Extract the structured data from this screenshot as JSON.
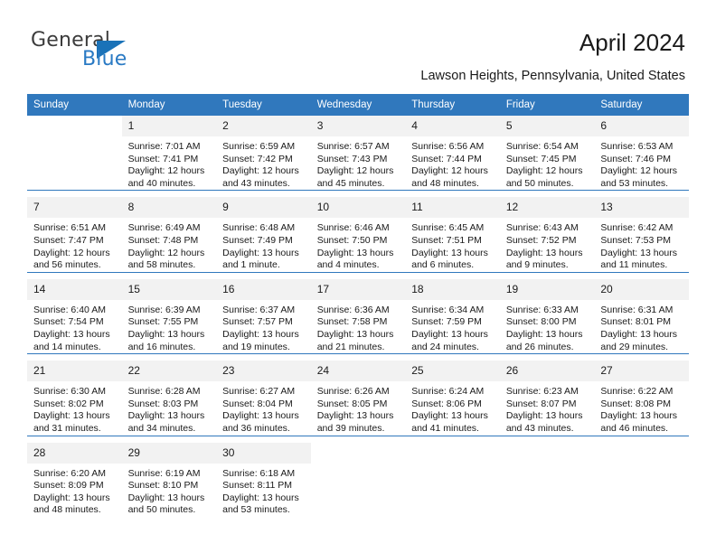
{
  "logo": {
    "word_top": "General",
    "word_bottom": "Blue",
    "accent_color": "#1a72b8"
  },
  "header": {
    "title": "April 2024",
    "location": "Lawson Heights, Pennsylvania, United States"
  },
  "theme": {
    "header_blue": "#3078bd",
    "daynum_band": "#f2f2f2"
  },
  "calendar": {
    "weekdays": [
      "Sunday",
      "Monday",
      "Tuesday",
      "Wednesday",
      "Thursday",
      "Friday",
      "Saturday"
    ],
    "weeks": [
      [
        {
          "day": "",
          "sunrise": "",
          "sunset": "",
          "daylight": ""
        },
        {
          "day": "1",
          "sunrise": "Sunrise: 7:01 AM",
          "sunset": "Sunset: 7:41 PM",
          "daylight": "Daylight: 12 hours and 40 minutes."
        },
        {
          "day": "2",
          "sunrise": "Sunrise: 6:59 AM",
          "sunset": "Sunset: 7:42 PM",
          "daylight": "Daylight: 12 hours and 43 minutes."
        },
        {
          "day": "3",
          "sunrise": "Sunrise: 6:57 AM",
          "sunset": "Sunset: 7:43 PM",
          "daylight": "Daylight: 12 hours and 45 minutes."
        },
        {
          "day": "4",
          "sunrise": "Sunrise: 6:56 AM",
          "sunset": "Sunset: 7:44 PM",
          "daylight": "Daylight: 12 hours and 48 minutes."
        },
        {
          "day": "5",
          "sunrise": "Sunrise: 6:54 AM",
          "sunset": "Sunset: 7:45 PM",
          "daylight": "Daylight: 12 hours and 50 minutes."
        },
        {
          "day": "6",
          "sunrise": "Sunrise: 6:53 AM",
          "sunset": "Sunset: 7:46 PM",
          "daylight": "Daylight: 12 hours and 53 minutes."
        }
      ],
      [
        {
          "day": "7",
          "sunrise": "Sunrise: 6:51 AM",
          "sunset": "Sunset: 7:47 PM",
          "daylight": "Daylight: 12 hours and 56 minutes."
        },
        {
          "day": "8",
          "sunrise": "Sunrise: 6:49 AM",
          "sunset": "Sunset: 7:48 PM",
          "daylight": "Daylight: 12 hours and 58 minutes."
        },
        {
          "day": "9",
          "sunrise": "Sunrise: 6:48 AM",
          "sunset": "Sunset: 7:49 PM",
          "daylight": "Daylight: 13 hours and 1 minute."
        },
        {
          "day": "10",
          "sunrise": "Sunrise: 6:46 AM",
          "sunset": "Sunset: 7:50 PM",
          "daylight": "Daylight: 13 hours and 4 minutes."
        },
        {
          "day": "11",
          "sunrise": "Sunrise: 6:45 AM",
          "sunset": "Sunset: 7:51 PM",
          "daylight": "Daylight: 13 hours and 6 minutes."
        },
        {
          "day": "12",
          "sunrise": "Sunrise: 6:43 AM",
          "sunset": "Sunset: 7:52 PM",
          "daylight": "Daylight: 13 hours and 9 minutes."
        },
        {
          "day": "13",
          "sunrise": "Sunrise: 6:42 AM",
          "sunset": "Sunset: 7:53 PM",
          "daylight": "Daylight: 13 hours and 11 minutes."
        }
      ],
      [
        {
          "day": "14",
          "sunrise": "Sunrise: 6:40 AM",
          "sunset": "Sunset: 7:54 PM",
          "daylight": "Daylight: 13 hours and 14 minutes."
        },
        {
          "day": "15",
          "sunrise": "Sunrise: 6:39 AM",
          "sunset": "Sunset: 7:55 PM",
          "daylight": "Daylight: 13 hours and 16 minutes."
        },
        {
          "day": "16",
          "sunrise": "Sunrise: 6:37 AM",
          "sunset": "Sunset: 7:57 PM",
          "daylight": "Daylight: 13 hours and 19 minutes."
        },
        {
          "day": "17",
          "sunrise": "Sunrise: 6:36 AM",
          "sunset": "Sunset: 7:58 PM",
          "daylight": "Daylight: 13 hours and 21 minutes."
        },
        {
          "day": "18",
          "sunrise": "Sunrise: 6:34 AM",
          "sunset": "Sunset: 7:59 PM",
          "daylight": "Daylight: 13 hours and 24 minutes."
        },
        {
          "day": "19",
          "sunrise": "Sunrise: 6:33 AM",
          "sunset": "Sunset: 8:00 PM",
          "daylight": "Daylight: 13 hours and 26 minutes."
        },
        {
          "day": "20",
          "sunrise": "Sunrise: 6:31 AM",
          "sunset": "Sunset: 8:01 PM",
          "daylight": "Daylight: 13 hours and 29 minutes."
        }
      ],
      [
        {
          "day": "21",
          "sunrise": "Sunrise: 6:30 AM",
          "sunset": "Sunset: 8:02 PM",
          "daylight": "Daylight: 13 hours and 31 minutes."
        },
        {
          "day": "22",
          "sunrise": "Sunrise: 6:28 AM",
          "sunset": "Sunset: 8:03 PM",
          "daylight": "Daylight: 13 hours and 34 minutes."
        },
        {
          "day": "23",
          "sunrise": "Sunrise: 6:27 AM",
          "sunset": "Sunset: 8:04 PM",
          "daylight": "Daylight: 13 hours and 36 minutes."
        },
        {
          "day": "24",
          "sunrise": "Sunrise: 6:26 AM",
          "sunset": "Sunset: 8:05 PM",
          "daylight": "Daylight: 13 hours and 39 minutes."
        },
        {
          "day": "25",
          "sunrise": "Sunrise: 6:24 AM",
          "sunset": "Sunset: 8:06 PM",
          "daylight": "Daylight: 13 hours and 41 minutes."
        },
        {
          "day": "26",
          "sunrise": "Sunrise: 6:23 AM",
          "sunset": "Sunset: 8:07 PM",
          "daylight": "Daylight: 13 hours and 43 minutes."
        },
        {
          "day": "27",
          "sunrise": "Sunrise: 6:22 AM",
          "sunset": "Sunset: 8:08 PM",
          "daylight": "Daylight: 13 hours and 46 minutes."
        }
      ],
      [
        {
          "day": "28",
          "sunrise": "Sunrise: 6:20 AM",
          "sunset": "Sunset: 8:09 PM",
          "daylight": "Daylight: 13 hours and 48 minutes."
        },
        {
          "day": "29",
          "sunrise": "Sunrise: 6:19 AM",
          "sunset": "Sunset: 8:10 PM",
          "daylight": "Daylight: 13 hours and 50 minutes."
        },
        {
          "day": "30",
          "sunrise": "Sunrise: 6:18 AM",
          "sunset": "Sunset: 8:11 PM",
          "daylight": "Daylight: 13 hours and 53 minutes."
        },
        {
          "day": "",
          "sunrise": "",
          "sunset": "",
          "daylight": ""
        },
        {
          "day": "",
          "sunrise": "",
          "sunset": "",
          "daylight": ""
        },
        {
          "day": "",
          "sunrise": "",
          "sunset": "",
          "daylight": ""
        },
        {
          "day": "",
          "sunrise": "",
          "sunset": "",
          "daylight": ""
        }
      ]
    ]
  }
}
